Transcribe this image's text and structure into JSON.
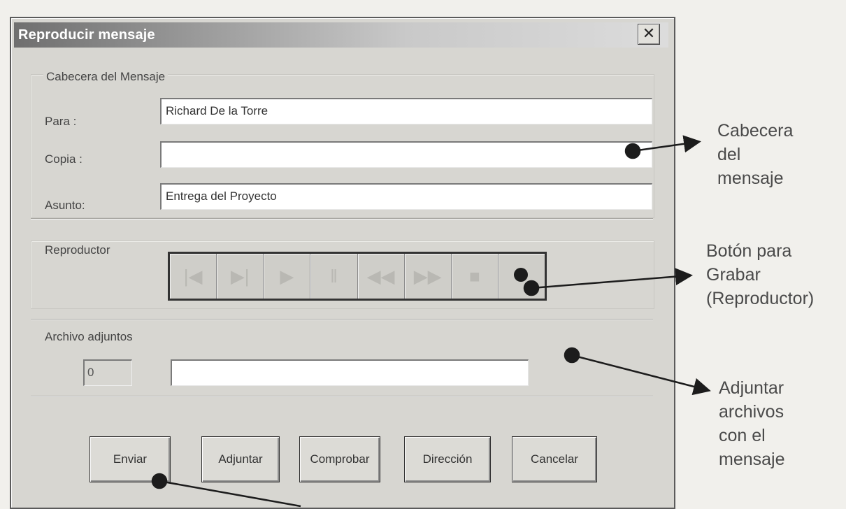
{
  "window": {
    "title": "Reproducir mensaje",
    "close_symbol": "✕"
  },
  "header_group": {
    "label": "Cabecera del Mensaje",
    "to_label": "Para :",
    "to_value": "Richard De la Torre",
    "cc_label": "Copia :",
    "cc_value": "",
    "subject_label": "Asunto:",
    "subject_value": "Entrega del Proyecto"
  },
  "player_group": {
    "label": "Reproductor",
    "buttons": [
      {
        "icon": "skip-back-icon",
        "glyph": "|◀"
      },
      {
        "icon": "step-icon",
        "glyph": "▶|"
      },
      {
        "icon": "play-icon",
        "glyph": "▶"
      },
      {
        "icon": "pause-icon",
        "glyph": "‖"
      },
      {
        "icon": "rewind-icon",
        "glyph": "◀◀"
      },
      {
        "icon": "fast-forward-icon",
        "glyph": "▶▶"
      },
      {
        "icon": "stop-icon",
        "glyph": "■"
      },
      {
        "icon": "record-icon",
        "glyph": ""
      }
    ]
  },
  "attachments_group": {
    "label": "Archivo adjuntos",
    "count": "0",
    "file_value": ""
  },
  "buttons": {
    "send": "Enviar",
    "attach": "Adjuntar",
    "check": "Comprobar",
    "address": "Dirección",
    "cancel": "Cancelar"
  },
  "callouts": {
    "header": [
      "Cabecera",
      "del",
      "mensaje"
    ],
    "record": [
      "Botón para",
      "Grabar",
      "(Reproductor)"
    ],
    "attach": [
      "Adjuntar",
      "archivos",
      "con el",
      "mensaje"
    ]
  },
  "colors": {
    "annotation": "#1c1c1c",
    "dialog_bg": "#d7d6d1"
  }
}
